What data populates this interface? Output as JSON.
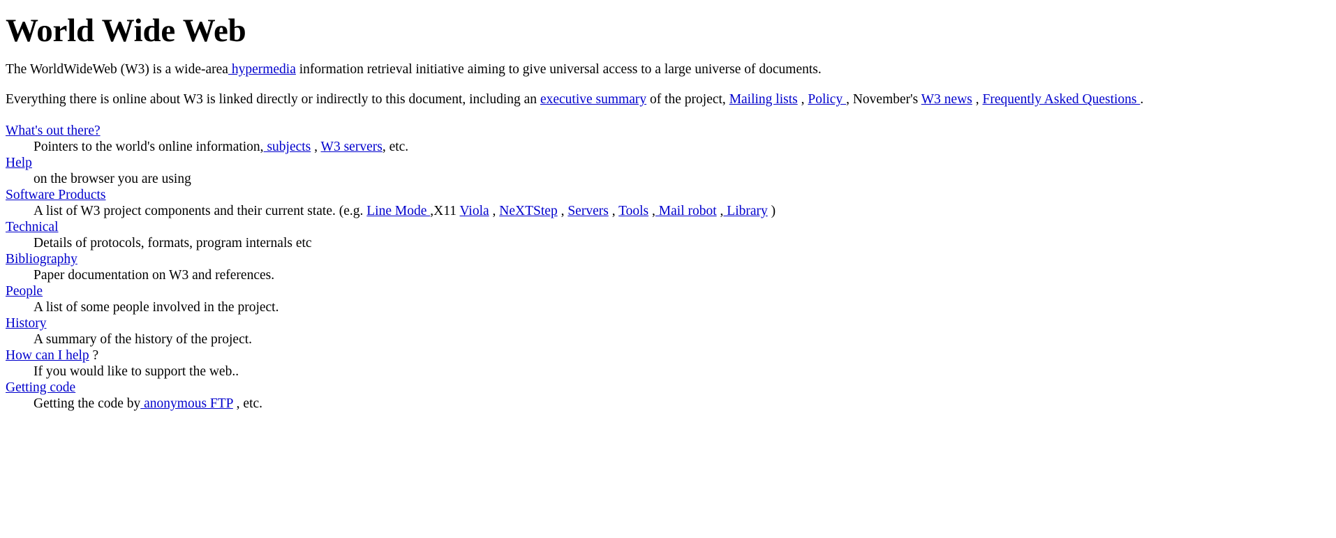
{
  "document": {
    "title": "World Wide Web",
    "link_color": "#0000CC",
    "text_color": "#000000",
    "background_color": "#FFFFFF"
  },
  "intro": {
    "p1": {
      "before_link": "The WorldWideWeb (W3) is a wide-area",
      "link": " hypermedia",
      "after_link": " information retrieval initiative aiming to give universal access to a large universe of documents."
    },
    "p2": {
      "s1": "Everything there is online about W3 is linked directly or indirectly to this document, including an ",
      "link1": "executive summary",
      "s2": " of the project, ",
      "link2": "Mailing lists",
      "s3": " , ",
      "link3": "Policy ",
      "s4": ", November's ",
      "link4": "W3 news",
      "s5": " , ",
      "link5": "Frequently Asked Questions ",
      "s6": "."
    }
  },
  "sections": [
    {
      "term_link": "What's out there?",
      "term_suffix": "",
      "definition": {
        "s1": "Pointers to the world's online information,",
        "link1": " subjects",
        "s2": " , ",
        "link2": "W3 servers",
        "s3": ", etc."
      }
    },
    {
      "term_link": "Help",
      "term_suffix": "",
      "definition": {
        "s1": "on the browser you are using"
      }
    },
    {
      "term_link": "Software Products",
      "term_suffix": "",
      "definition": {
        "s1": "A list of W3 project components and their current state. (e.g. ",
        "link1": "Line Mode ",
        "s2": ",X11 ",
        "link2": "Viola",
        "s3": " , ",
        "link3": "NeXTStep",
        "s4": " , ",
        "link4": "Servers",
        "s5": " , ",
        "link5": "Tools",
        "s6": " ,",
        "link6": " Mail robot",
        "s7": " ,",
        "link7": " Library",
        "s8": " )"
      }
    },
    {
      "term_link": "Technical",
      "term_suffix": "",
      "definition": {
        "s1": "Details of protocols, formats, program internals etc"
      }
    },
    {
      "term_link": "Bibliography",
      "term_suffix": "",
      "definition": {
        "s1": "Paper documentation on W3 and references."
      }
    },
    {
      "term_link": "People",
      "term_suffix": "",
      "definition": {
        "s1": "A list of some people involved in the project."
      }
    },
    {
      "term_link": "History",
      "term_suffix": "",
      "definition": {
        "s1": "A summary of the history of the project."
      }
    },
    {
      "term_link": "How can I help",
      "term_suffix": " ?",
      "definition": {
        "s1": "If you would like to support the web.."
      }
    },
    {
      "term_link": "Getting code",
      "term_suffix": "",
      "definition": {
        "s1": "Getting the code by",
        "link1": " anonymous FTP",
        "s2": " , etc."
      }
    }
  ]
}
